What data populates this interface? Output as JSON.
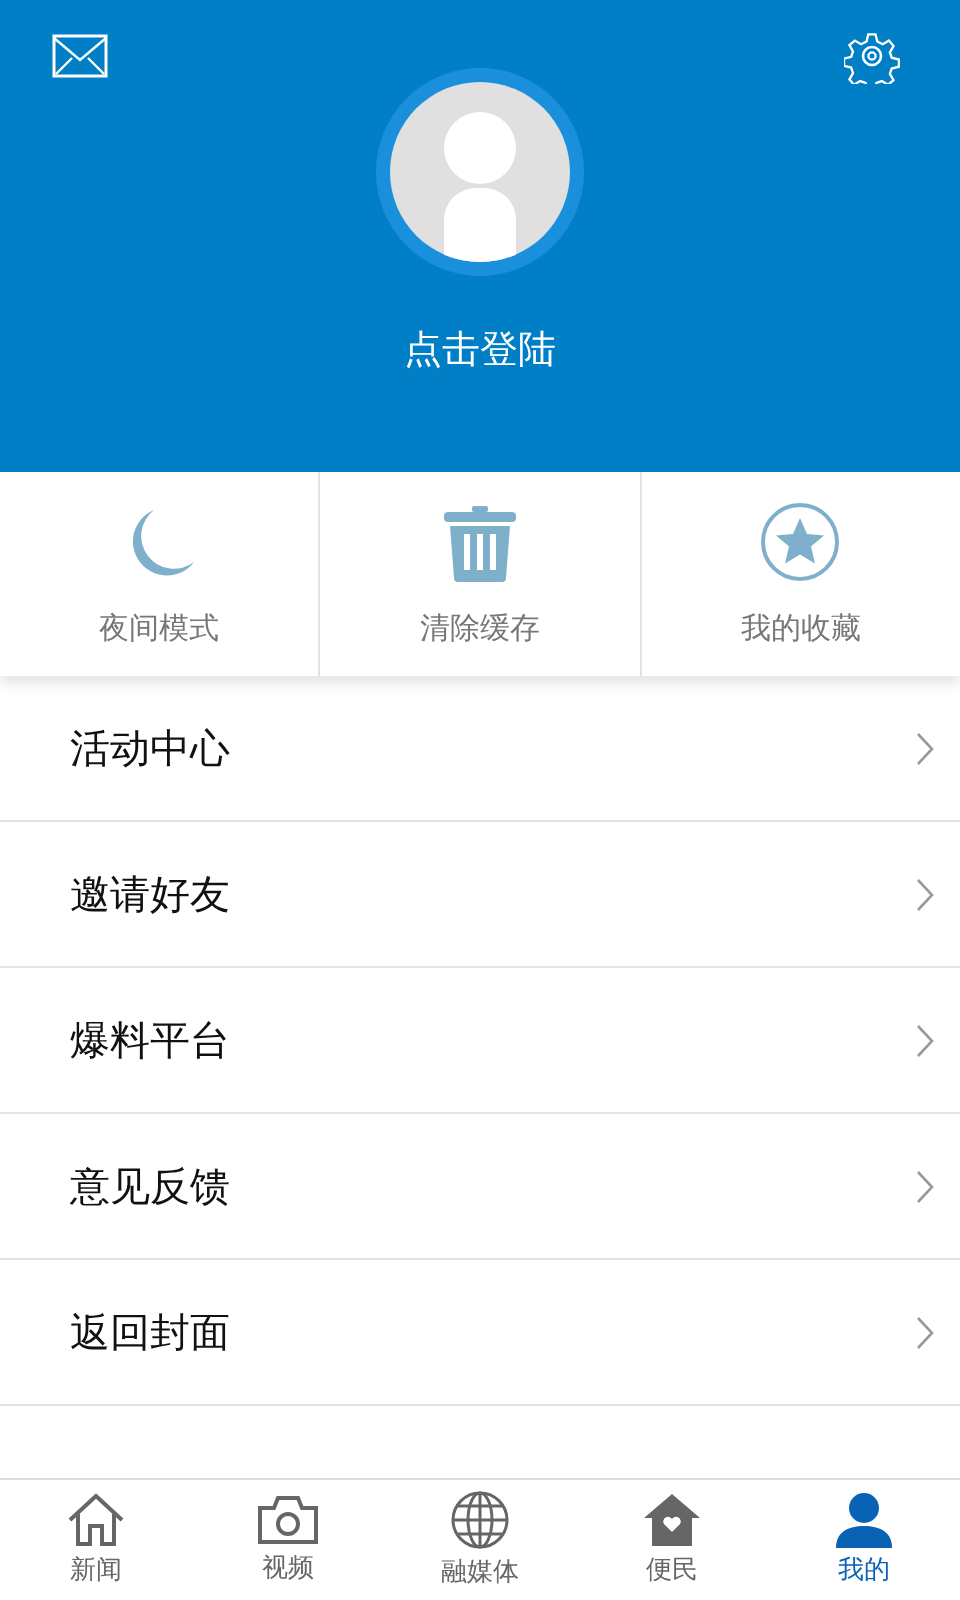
{
  "header": {
    "login_label": "点击登陆"
  },
  "quick_actions": [
    {
      "label": "夜间模式"
    },
    {
      "label": "清除缓存"
    },
    {
      "label": "我的收藏"
    }
  ],
  "menu": [
    {
      "label": "活动中心"
    },
    {
      "label": "邀请好友"
    },
    {
      "label": "爆料平台"
    },
    {
      "label": "意见反馈"
    },
    {
      "label": "返回封面"
    }
  ],
  "tabs": [
    {
      "label": "新闻",
      "selected": false
    },
    {
      "label": "视频",
      "selected": false
    },
    {
      "label": "融媒体",
      "selected": false
    },
    {
      "label": "便民",
      "selected": false
    },
    {
      "label": "我的",
      "selected": true
    }
  ]
}
